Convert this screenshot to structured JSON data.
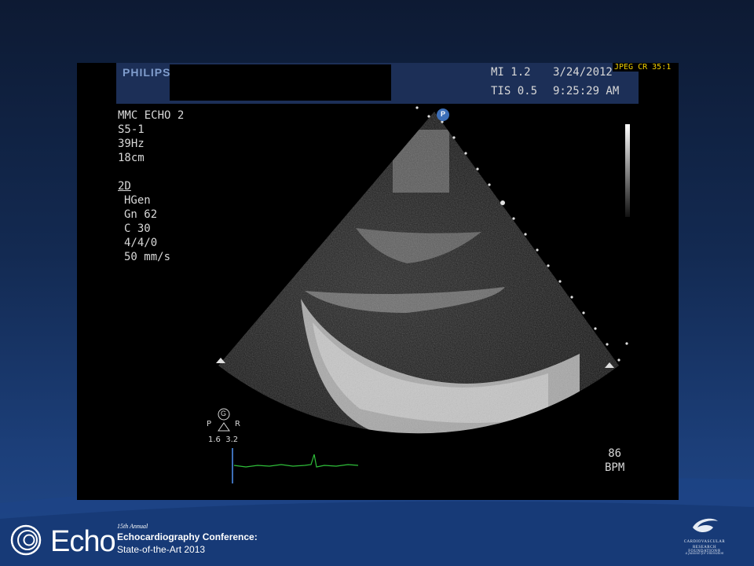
{
  "ultrasound": {
    "header": {
      "brand": "PHILIPS",
      "mi": "MI 1.2",
      "tis": "TIS 0.5",
      "date": "3/24/2012",
      "time": "9:25:29 AM",
      "compression": "JPEG CR 35:1"
    },
    "params": {
      "line1": "MMC ECHO 2",
      "line2": "S5-1",
      "line3": "39Hz",
      "line4": "18cm",
      "mode": "2D",
      "harmonic": "HGen",
      "gain": "Gn 62",
      "compress": "C 30",
      "persist": "4/4/0",
      "sweep": "50 mm/s"
    },
    "probe": {
      "marker": "P",
      "orientation_left": "P",
      "orientation_right": "R",
      "values": "1.6  3.2",
      "gen_symbol": "G"
    },
    "heart_rate": {
      "value": "86",
      "unit": "BPM"
    }
  },
  "footer": {
    "logo": "Echo",
    "annual": "15th Annual",
    "title": "Echocardiography Conference:",
    "subtitle": "State-of-the-Art 2013",
    "org_line1": "CARDIOVASCULAR",
    "org_line2": "RESEARCH FOUNDATION®",
    "org_tagline": "a passion for innovation"
  },
  "colors": {
    "ecg_trace": "#2fbf3a",
    "hud_text": "#d8d8d8",
    "header_bar": "#1c2f57",
    "jpeg_label": "#f0d000"
  }
}
